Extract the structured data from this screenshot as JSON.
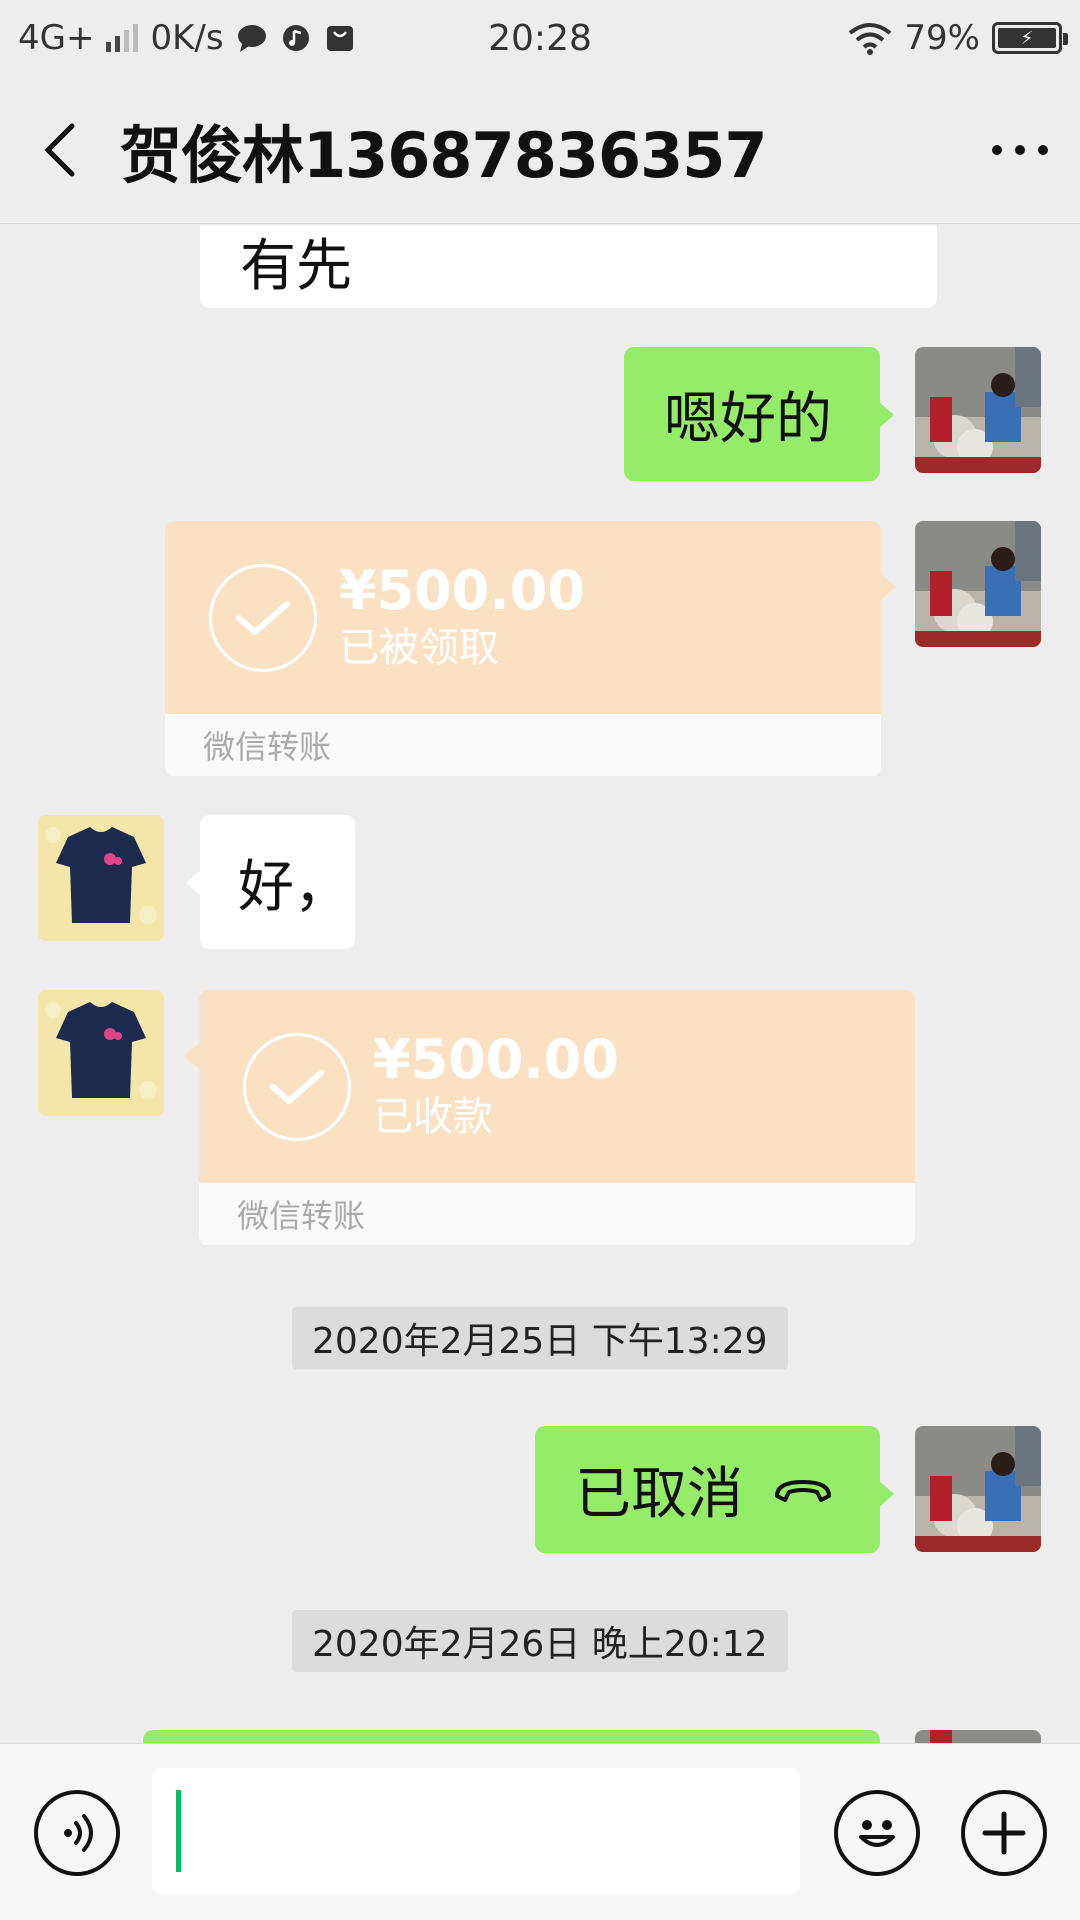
{
  "status_bar": {
    "network": "4G+",
    "speed": "0K/s",
    "time": "20:28",
    "battery_pct": "79%",
    "icons": [
      "signal-icon",
      "chat-notification-icon",
      "music-icon",
      "shopping-bag-icon",
      "wifi-icon",
      "battery-icon"
    ]
  },
  "nav": {
    "title": "贺俊林13687836357",
    "back_icon": "chevron-left-icon",
    "more_icon": "more-dots-icon"
  },
  "messages": {
    "m1_partial": "有先",
    "m2_sent": "嗯好的",
    "t1": {
      "amount": "¥500.00",
      "status": "已被领取",
      "footer": "微信转账"
    },
    "m3_received": "好，",
    "t2": {
      "amount": "¥500.00",
      "status": "已收款",
      "footer": "微信转账"
    },
    "ts1": "2020年2月25日 下午13:29",
    "m4_call": "已取消",
    "ts2": "2020年2月26日 晚上20:12"
  },
  "colors": {
    "sent_bubble": "#95ec69",
    "received_bubble": "#ffffff",
    "transfer": "#fbe1c4",
    "background": "#ededed",
    "caret": "#07c160"
  },
  "input": {
    "placeholder": ""
  }
}
